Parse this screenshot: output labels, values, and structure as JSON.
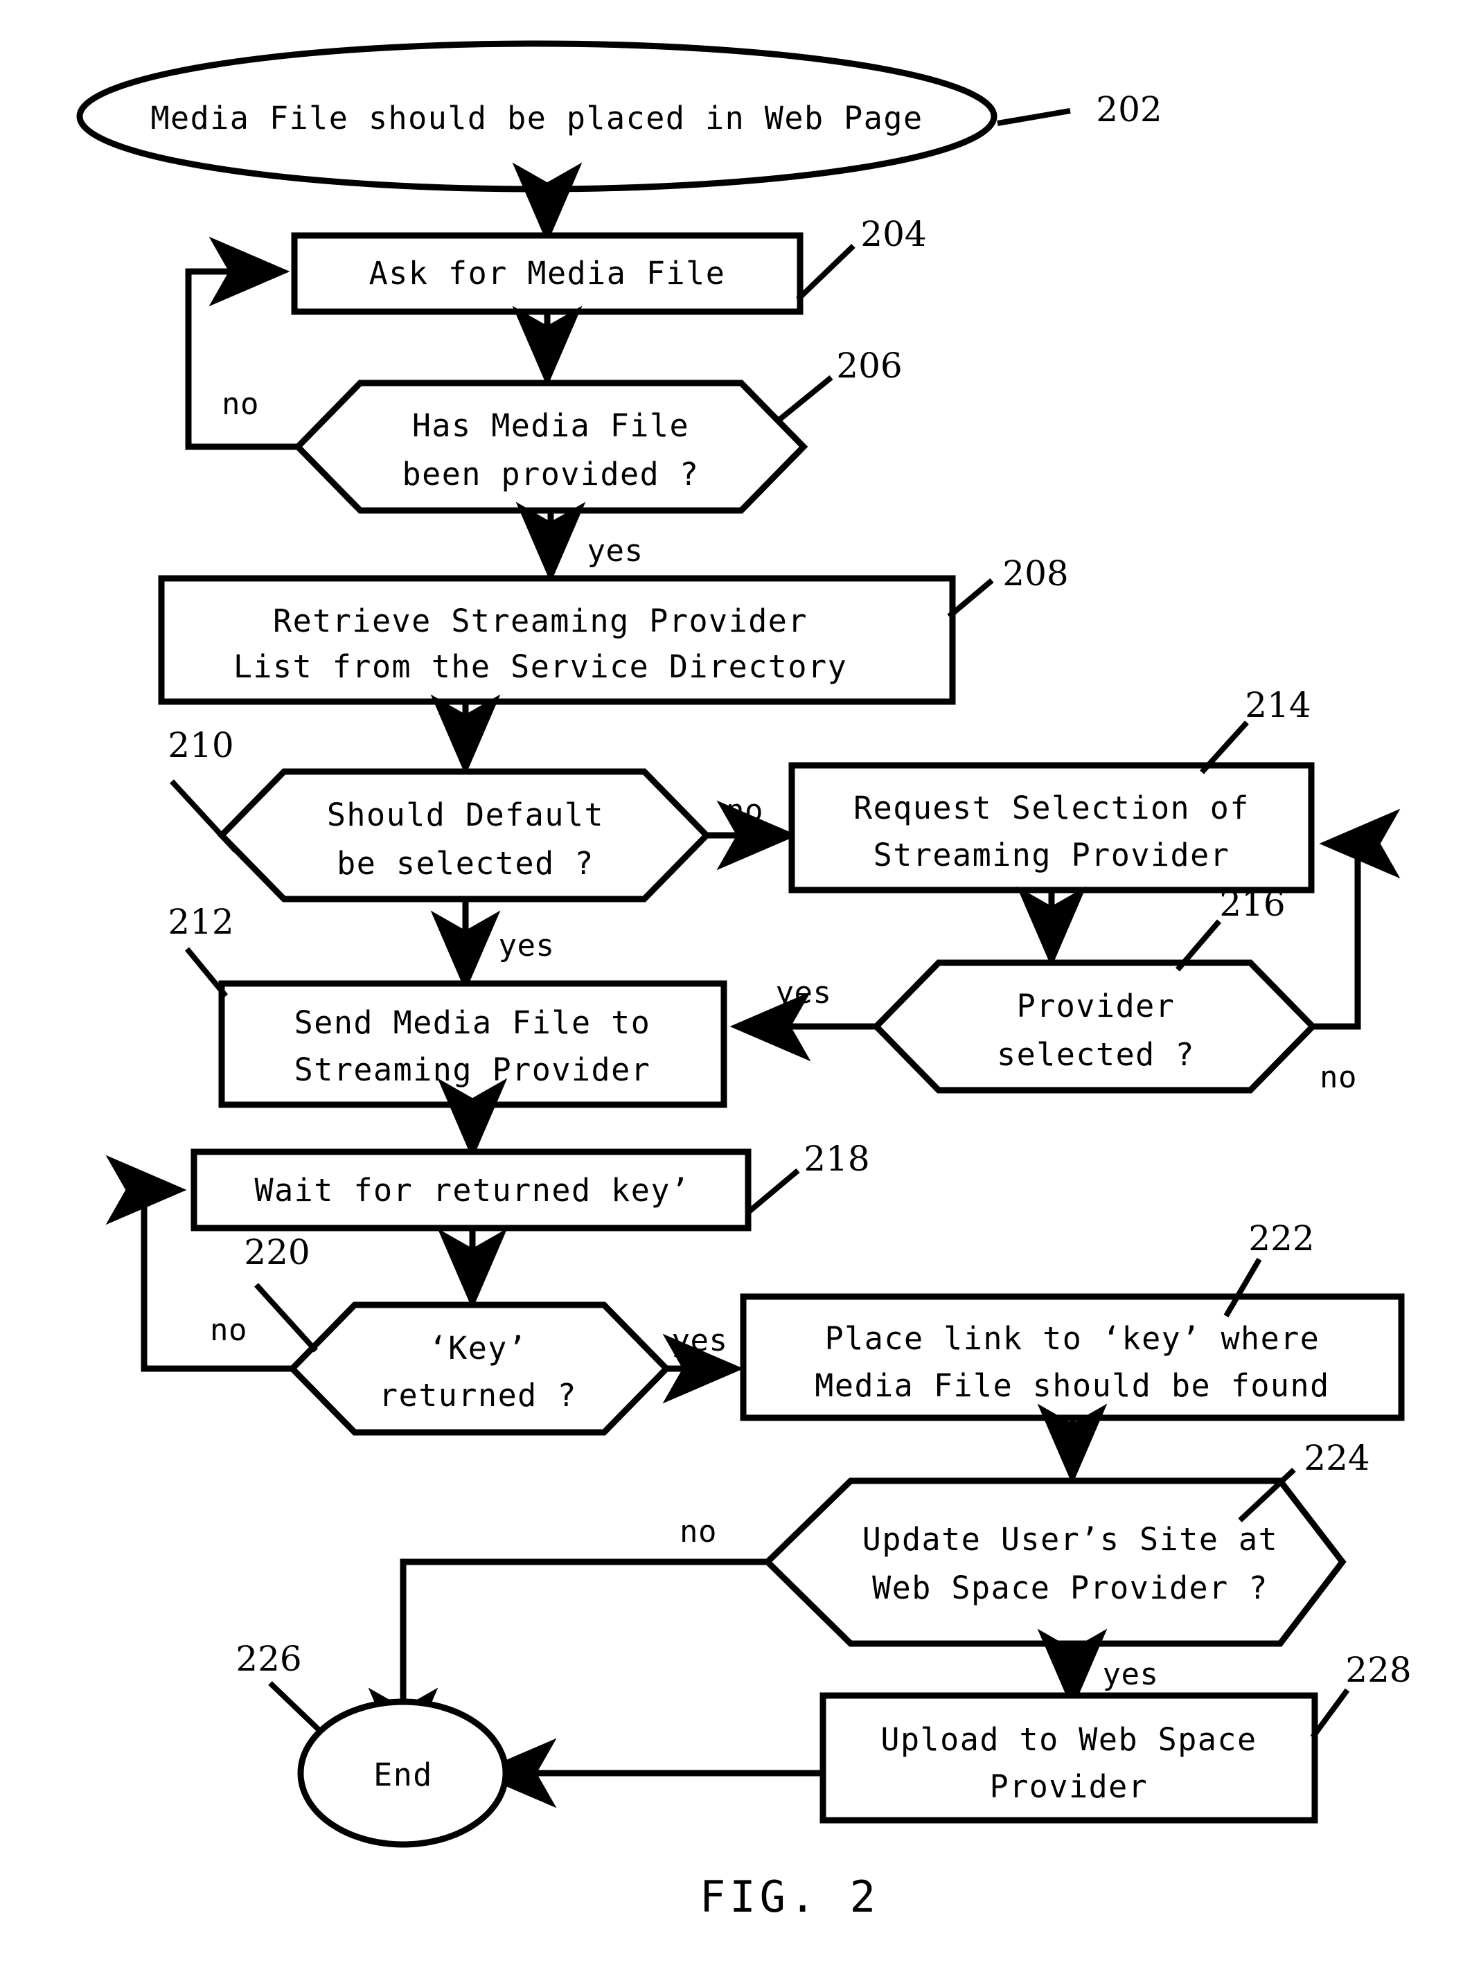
{
  "figure": {
    "caption": "FIG. 2",
    "title_text": "Media File should be placed in Web Page"
  },
  "nodes": {
    "start": {
      "ref": "202",
      "shape": "ellipse",
      "text": "Media File should be placed in Web Page"
    },
    "ask_media_file": {
      "ref": "204",
      "shape": "process",
      "line1": "Ask for Media File"
    },
    "has_media_file": {
      "ref": "206",
      "shape": "decision",
      "line1": "Has Media File",
      "line2": "been provided ?"
    },
    "retrieve_list": {
      "ref": "208",
      "shape": "process",
      "line1": "Retrieve Streaming Provider",
      "line2": "List from the Service Directory"
    },
    "should_default": {
      "ref": "210",
      "shape": "decision",
      "line1": "Should Default",
      "line2": "be selected ?"
    },
    "send_media_file": {
      "ref": "212",
      "shape": "process",
      "line1": "Send Media File to",
      "line2": "Streaming Provider"
    },
    "request_selection": {
      "ref": "214",
      "shape": "process",
      "line1": "Request Selection of",
      "line2": "Streaming Provider"
    },
    "provider_selected": {
      "ref": "216",
      "shape": "decision",
      "line1": "Provider",
      "line2": "selected ?"
    },
    "wait_for_key": {
      "ref": "218",
      "shape": "process",
      "line1": "Wait for returned key’"
    },
    "key_returned": {
      "ref": "220",
      "shape": "decision",
      "line1": "‘Key’",
      "line2": "returned ?"
    },
    "place_link": {
      "ref": "222",
      "shape": "process",
      "line1": "Place link to ‘key’ where",
      "line2": "Media File should be found"
    },
    "update_site": {
      "ref": "224",
      "shape": "decision",
      "line1": "Update User’s Site at",
      "line2": "Web Space Provider ?"
    },
    "end": {
      "ref": "226",
      "shape": "ellipse",
      "text": "End"
    },
    "upload_web_space": {
      "ref": "228",
      "shape": "process",
      "line1": "Upload to Web Space",
      "line2": "Provider"
    }
  },
  "edge_labels": {
    "has_media_file_no": "no",
    "has_media_file_yes": "yes",
    "should_default_no": "no",
    "should_default_yes": "yes",
    "provider_selected_yes": "yes",
    "provider_selected_no": "no",
    "key_returned_no": "no",
    "key_returned_yes": "yes",
    "update_site_no": "no",
    "update_site_yes": "yes"
  },
  "colors": {
    "ink": "#000000",
    "paper": "#ffffff"
  }
}
